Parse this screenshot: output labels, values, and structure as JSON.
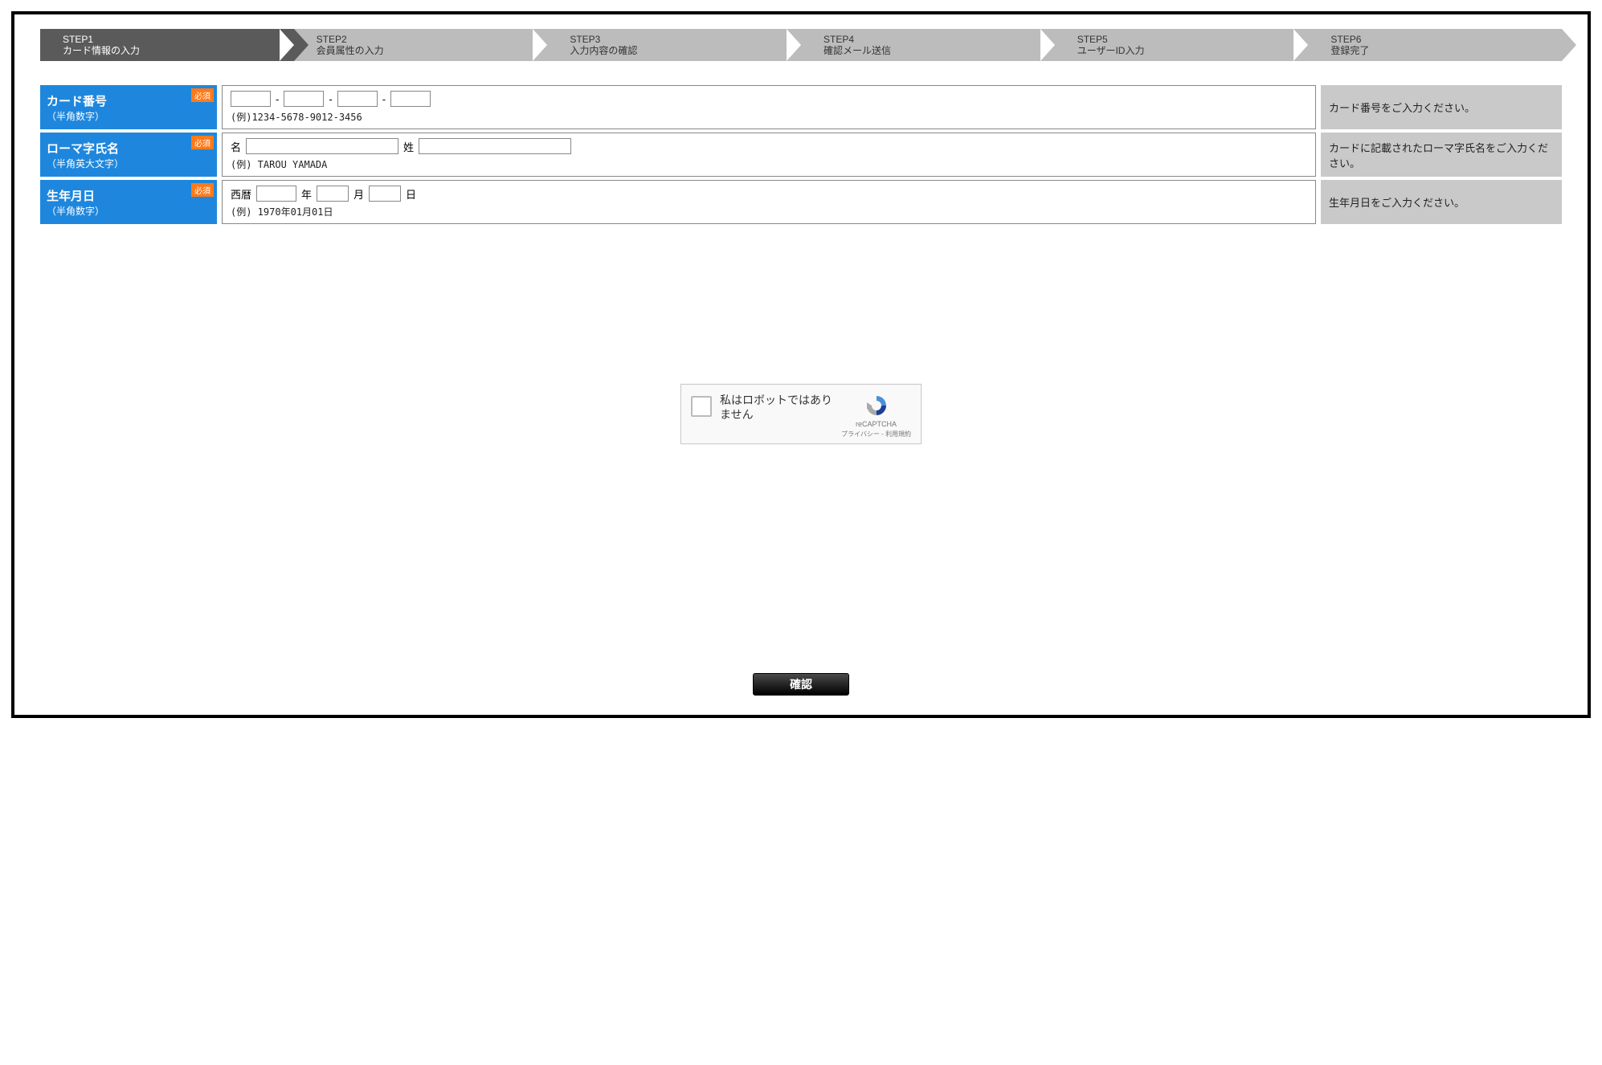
{
  "stepper": [
    {
      "line1": "STEP1",
      "line2": "カード情報の入力",
      "active": true
    },
    {
      "line1": "STEP2",
      "line2": "会員属性の入力",
      "active": false
    },
    {
      "line1": "STEP3",
      "line2": "入力内容の確認",
      "active": false
    },
    {
      "line1": "STEP4",
      "line2": "確認メール送信",
      "active": false
    },
    {
      "line1": "STEP5",
      "line2": "ユーザーID入力",
      "active": false
    },
    {
      "line1": "STEP6",
      "line2": "登録完了",
      "active": false
    }
  ],
  "required_badge": "必須",
  "rows": {
    "card": {
      "label_main": "カード番号",
      "label_sub": "（半角数字）",
      "separator": "-",
      "example": "(例)1234-5678-9012-3456",
      "hint": "カード番号をご入力ください。"
    },
    "name": {
      "label_main": "ローマ字氏名",
      "label_sub": "（半角英大文字）",
      "first_label": "名",
      "last_label": "姓",
      "example": "(例) TAROU YAMADA",
      "hint": "カードに記載されたローマ字氏名をご入力ください。"
    },
    "dob": {
      "label_main": "生年月日",
      "label_sub": "（半角数字）",
      "era_label": "西暦",
      "year_suffix": "年",
      "month_suffix": "月",
      "day_suffix": "日",
      "example": "(例) 1970年01月01日",
      "hint": "生年月日をご入力ください。"
    }
  },
  "recaptcha": {
    "label": "私はロボットではありません",
    "brand": "reCAPTCHA",
    "privacy": "プライバシー",
    "terms": "利用規約",
    "dot": " - "
  },
  "confirm_button": "確認"
}
